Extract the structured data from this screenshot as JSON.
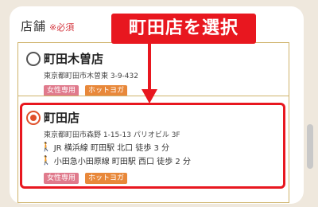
{
  "field": {
    "label": "店舗",
    "required": "※必須"
  },
  "annotation": {
    "text": "町田店を選択"
  },
  "stores": [
    {
      "name": "町田木曽店",
      "address": "東京都町田市木曽東 3-9-432",
      "selected": false,
      "tags": [
        "女性専用",
        "ホットヨガ"
      ]
    },
    {
      "name": "町田店",
      "address": "東京都町田市森野 1-15-13 パリオビル 3F",
      "selected": true,
      "access": [
        "JR 横浜線 町田駅 北口 徒歩 3 分",
        "小田急小田原線 町田駅 西口 徒歩 2 分"
      ],
      "tags": [
        "女性専用",
        "ホットヨガ"
      ]
    }
  ],
  "colors": {
    "accent": "#e8171f",
    "gold_border": "#cfb36b",
    "radio_selected": "#e0502a"
  },
  "icons": {
    "access": "walking-person-icon"
  }
}
